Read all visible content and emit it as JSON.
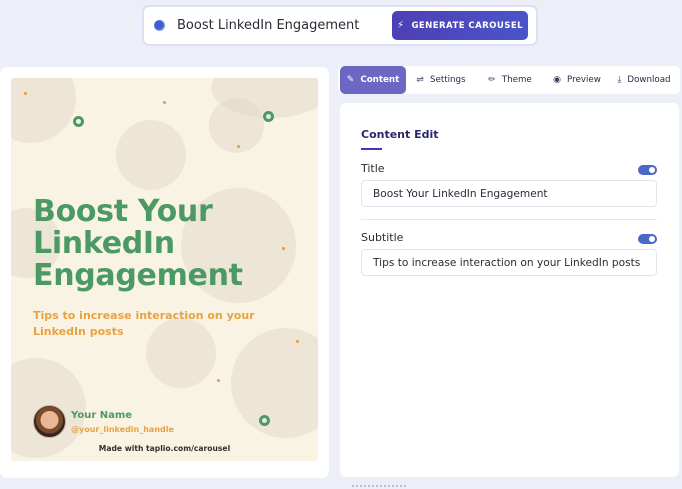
{
  "prompt": {
    "text": "Boost LinkedIn Engagement",
    "generate_label": "GENERATE CAROUSEL"
  },
  "tabs": [
    {
      "label": "Content",
      "icon": "pencil-icon"
    },
    {
      "label": "Settings",
      "icon": "sliders-icon"
    },
    {
      "label": "Theme",
      "icon": "brush-icon"
    },
    {
      "label": "Preview",
      "icon": "eye-icon"
    },
    {
      "label": "Download",
      "icon": "download-icon"
    }
  ],
  "slide": {
    "title": "Boost Your LinkedIn Engagement",
    "subtitle": "Tips to increase interaction on your LinkedIn posts",
    "author_name": "Your Name",
    "author_handle": "@your_linkedin_handle",
    "made_with": "Made with taplio.com/carousel",
    "title_color": "#4b9a63",
    "accent_color": "#e8a243",
    "background_color": "#f9f3e4"
  },
  "editor": {
    "heading": "Content Edit",
    "fields": [
      {
        "label": "Title",
        "value": "Boost Your LinkedIn Engagement",
        "enabled": true
      },
      {
        "label": "Subtitle",
        "value": "Tips to increase interaction on your LinkedIn posts",
        "enabled": true
      }
    ]
  },
  "colors": {
    "primary": "#4e3fb4",
    "tab_active": "#6b67c3",
    "toggle_on": "#4a69c7"
  }
}
